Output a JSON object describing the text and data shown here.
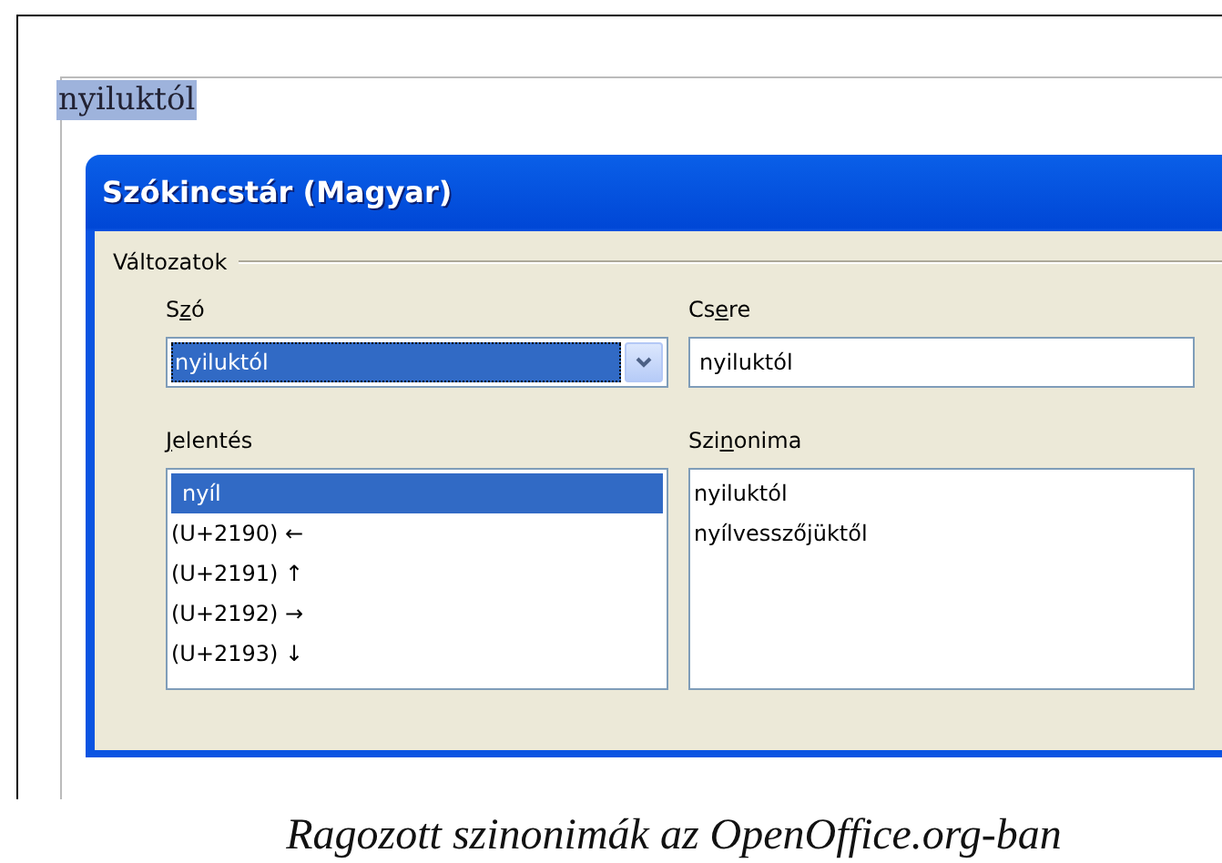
{
  "document": {
    "selected_text": "nyiluktól"
  },
  "dialog": {
    "title": "Szókincstár (Magyar)",
    "group": {
      "label": "Változatok"
    },
    "word": {
      "label": {
        "before": "S",
        "key": "z",
        "after": "ó"
      },
      "value": "nyiluktól"
    },
    "replace": {
      "label": {
        "before": "Cs",
        "key": "e",
        "after": "re"
      },
      "value": "nyiluktól"
    },
    "meanings": {
      "label": {
        "key": "J",
        "after": "elentés"
      },
      "items": [
        {
          "text": "nyíl",
          "selected": true
        },
        {
          "text": "(U+2190) ←",
          "selected": false
        },
        {
          "text": "(U+2191) ↑",
          "selected": false
        },
        {
          "text": "(U+2192) →",
          "selected": false
        },
        {
          "text": "(U+2193) ↓",
          "selected": false
        }
      ]
    },
    "synonyms": {
      "label": {
        "before": "Szi",
        "key": "n",
        "after": "onima"
      },
      "items": [
        {
          "text": "nyiluktól",
          "selected": false
        },
        {
          "text": "nyílvesszőjüktől",
          "selected": false
        }
      ]
    }
  },
  "caption": "Ragozott szinonimák az OpenOffice.org-ban"
}
